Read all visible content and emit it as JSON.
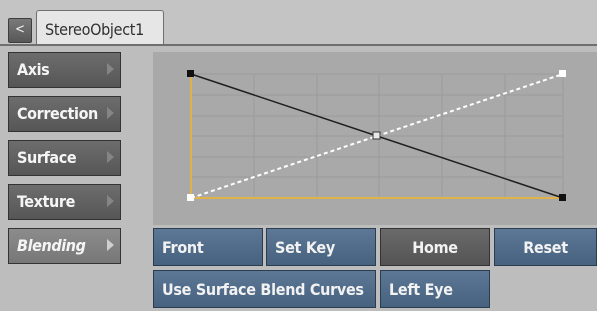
{
  "header": {
    "back_glyph": "<",
    "tab_label": "StereoObject1"
  },
  "sidebar": {
    "items": [
      {
        "label": "Axis",
        "selected": false
      },
      {
        "label": "Correction",
        "selected": false
      },
      {
        "label": "Surface",
        "selected": false
      },
      {
        "label": "Texture",
        "selected": false
      },
      {
        "label": "Blending",
        "selected": true
      }
    ]
  },
  "graph": {
    "colors": {
      "background": "#a9a9a9",
      "grid": "#9c9c9c",
      "frame": "#e0b24a",
      "curve_front": "#ffffff",
      "curve_back": "#1f1f1f"
    }
  },
  "buttons": {
    "front": "Front",
    "set_key": "Set Key",
    "home": "Home",
    "reset": "Reset",
    "use_surface_blend_curves": "Use Surface Blend Curves",
    "left_eye": "Left Eye"
  }
}
